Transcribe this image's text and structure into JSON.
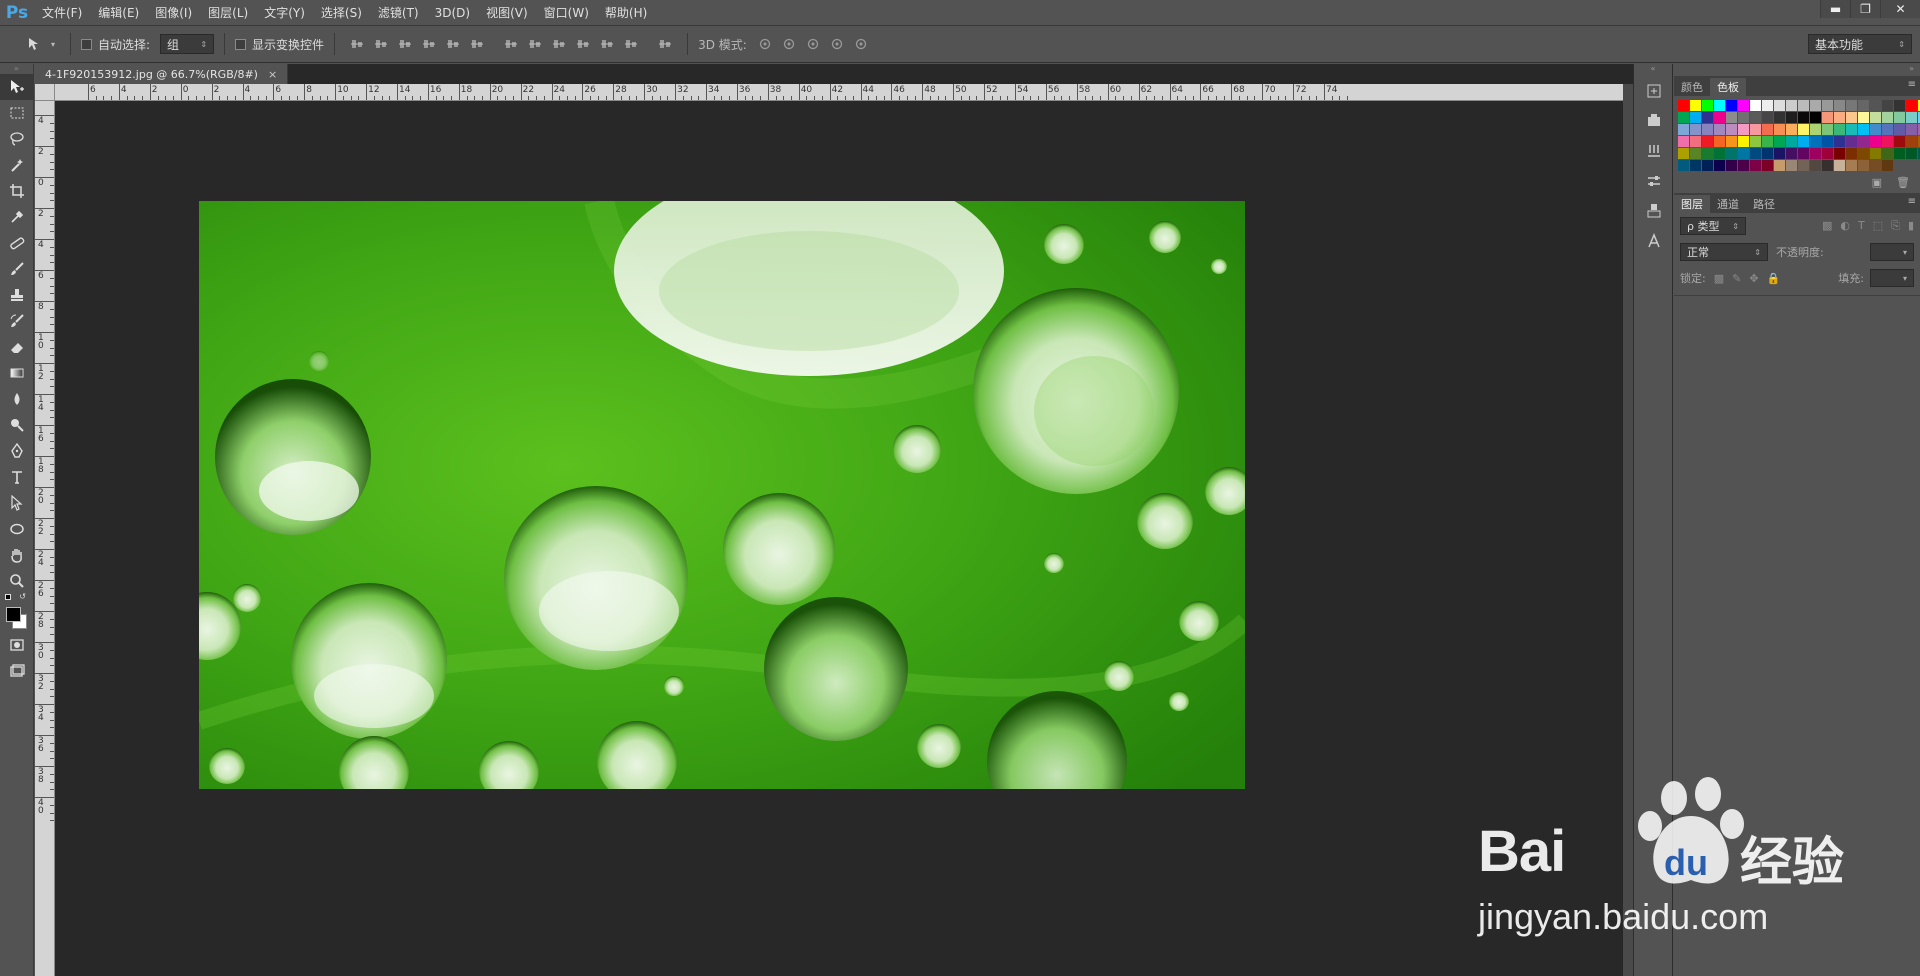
{
  "app": {
    "logo": "Ps"
  },
  "menu": [
    "文件(F)",
    "编辑(E)",
    "图像(I)",
    "图层(L)",
    "文字(Y)",
    "选择(S)",
    "滤镜(T)",
    "3D(D)",
    "视图(V)",
    "窗口(W)",
    "帮助(H)"
  ],
  "window_controls": {
    "minimize": "▬",
    "restore": "❐",
    "close": "✕"
  },
  "options": {
    "auto_select_label": "自动选择:",
    "auto_select_value": "组",
    "show_transform_label": "显示变换控件",
    "mode_3d_label": "3D 模式:",
    "workspace": "基本功能"
  },
  "document": {
    "tab_title": "4-1F920153912.jpg @ 66.7%(RGB/8#)",
    "tab_close": "×"
  },
  "ruler_top": [
    "6",
    "4",
    "2",
    "0",
    "2",
    "4",
    "6",
    "8",
    "10",
    "12",
    "14",
    "16",
    "18",
    "20",
    "22",
    "24",
    "26",
    "28",
    "30",
    "32",
    "34",
    "36",
    "38",
    "40",
    "42",
    "44",
    "46",
    "48",
    "50",
    "52",
    "54",
    "56",
    "58",
    "60",
    "62",
    "64",
    "66",
    "68",
    "70",
    "72",
    "74"
  ],
  "ruler_left": [
    "4",
    "2",
    "0",
    "2",
    "4",
    "6",
    "8",
    "10",
    "12",
    "14",
    "16",
    "18",
    "20",
    "22",
    "24",
    "26",
    "28",
    "30",
    "32",
    "34",
    "36",
    "38",
    "40"
  ],
  "panels": {
    "color_tabs": [
      "颜色",
      "色板"
    ],
    "layers_tabs": [
      "图层",
      "通道",
      "路径"
    ],
    "kind_label": "ρ 类型",
    "blend_mode": "正常",
    "opacity_label": "不透明度:",
    "lock_label": "锁定:",
    "fill_label": "填充:"
  },
  "swatch_colors": [
    "#ff0000",
    "#ffff00",
    "#00ff00",
    "#00ffff",
    "#0000ff",
    "#ff00ff",
    "#ffffff",
    "#eeeeee",
    "#dddddd",
    "#cccccc",
    "#bbbbbb",
    "#aaaaaa",
    "#999999",
    "#888888",
    "#777777",
    "#666666",
    "#555555",
    "#444444",
    "#333333",
    "#ff0000",
    "#ffff00",
    "#00a651",
    "#00aeef",
    "#2e3192",
    "#ec008c",
    "#8c8c8c",
    "#707070",
    "#5a5a5a",
    "#464646",
    "#323232",
    "#1e1e1e",
    "#0a0a0a",
    "#000000",
    "#f7977a",
    "#f9ad81",
    "#fdc68a",
    "#fff79a",
    "#c4df9b",
    "#a3d39c",
    "#82ca9d",
    "#7bcdc8",
    "#6ecff6",
    "#7ea7d8",
    "#8493ca",
    "#8882be",
    "#a187be",
    "#bc8cbf",
    "#f49ac2",
    "#f6989d",
    "#f26c4f",
    "#f68e55",
    "#fbaf5c",
    "#fff467",
    "#acd372",
    "#7cc576",
    "#3bb878",
    "#1abbb4",
    "#00bff3",
    "#438ccb",
    "#5574b9",
    "#605ca8",
    "#855fa8",
    "#a763a8",
    "#f06eaa",
    "#f26d7d",
    "#ed1c24",
    "#f26522",
    "#f7941d",
    "#fff200",
    "#8dc63f",
    "#39b54a",
    "#00a651",
    "#00a99d",
    "#00aeef",
    "#0072bc",
    "#0054a6",
    "#2e3192",
    "#662d91",
    "#92278f",
    "#ec008c",
    "#ed145b",
    "#9e0b0f",
    "#a0410d",
    "#a3620a",
    "#aba000",
    "#598527",
    "#197b30",
    "#007236",
    "#00746b",
    "#0076a3",
    "#004a80",
    "#003471",
    "#1b1464",
    "#440e62",
    "#630460",
    "#9e005d",
    "#9e0039",
    "#790000",
    "#7b2e00",
    "#7d4900",
    "#827b00",
    "#406618",
    "#005e20",
    "#005826",
    "#005952",
    "#005b7f",
    "#003663",
    "#002157",
    "#0d004c",
    "#32004b",
    "#4b0049",
    "#7b0046",
    "#7a0026",
    "#c69c6d",
    "#998675",
    "#736357",
    "#534741",
    "#362f2d",
    "#c7b299",
    "#a67c52",
    "#8c6239",
    "#754c24",
    "#603913"
  ],
  "watermark": {
    "brand": "Bai",
    "brand2": "du",
    "cn": "经验",
    "url": "jingyan.baidu.com"
  }
}
